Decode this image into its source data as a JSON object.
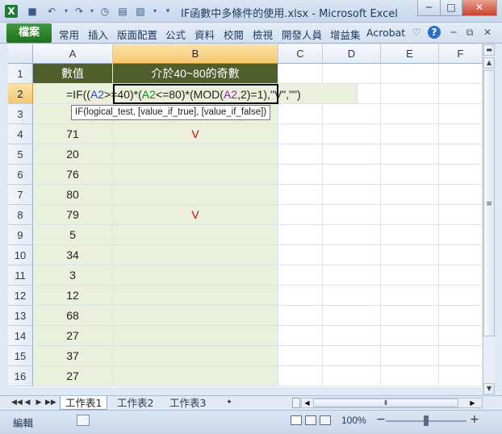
{
  "window": {
    "title": "IF函數中多條件的使用.xlsx - Microsoft Excel",
    "minimize": "─",
    "restore": "□",
    "close": "✕"
  },
  "quick_access": [
    "excel-app-icon",
    "save-icon",
    "undo-icon",
    "redo-icon",
    "clock-icon",
    "print-icon",
    "print-preview-icon",
    "customize-dropdown-icon"
  ],
  "ribbon": {
    "file_tab": "檔案",
    "tabs": [
      "常用",
      "插入",
      "版面配置",
      "公式",
      "資料",
      "校閱",
      "檢視",
      "開發人員",
      "增益集",
      "Acrobat"
    ],
    "icons": {
      "heart": "♡",
      "help": "?"
    }
  },
  "columns": [
    "A",
    "B",
    "C",
    "D",
    "E",
    "F"
  ],
  "rows": [
    "1",
    "2",
    "3",
    "4",
    "5",
    "6",
    "7",
    "8",
    "9",
    "10",
    "11",
    "12",
    "13",
    "14",
    "15",
    "16"
  ],
  "header_row": {
    "a": "數值",
    "b": "介於40~80的奇數"
  },
  "formula": {
    "p1": "=IF((",
    "p2": "A2",
    "p3": ">=40)*(",
    "p4": "A2",
    "p5": "<=80)*(MOD(",
    "p6": "A2",
    "p7": ",2)=1),\"V\",\"\")"
  },
  "tooltip": "IF(logical_test, [value_if_true], [value_if_false])",
  "data_rows": [
    {
      "row": "3",
      "a": "",
      "b": ""
    },
    {
      "row": "4",
      "a": "71",
      "b": "V"
    },
    {
      "row": "5",
      "a": "20",
      "b": ""
    },
    {
      "row": "6",
      "a": "76",
      "b": ""
    },
    {
      "row": "7",
      "a": "80",
      "b": ""
    },
    {
      "row": "8",
      "a": "79",
      "b": "V"
    },
    {
      "row": "9",
      "a": "5",
      "b": ""
    },
    {
      "row": "10",
      "a": "34",
      "b": ""
    },
    {
      "row": "11",
      "a": "3",
      "b": ""
    },
    {
      "row": "12",
      "a": "12",
      "b": ""
    },
    {
      "row": "13",
      "a": "68",
      "b": ""
    },
    {
      "row": "14",
      "a": "27",
      "b": ""
    },
    {
      "row": "15",
      "a": "37",
      "b": ""
    },
    {
      "row": "16",
      "a": "27",
      "b": ""
    }
  ],
  "sheet_tabs": [
    "工作表1",
    "工作表2",
    "工作表3"
  ],
  "status": {
    "mode": "編輯",
    "zoom": "100%",
    "zoom_minus": "−",
    "zoom_plus": "+"
  },
  "colors": {
    "header_fill": "#4f5e2b",
    "band_fill": "#eaf0dc",
    "mark_color": "#d00000",
    "file_tab": "#2a7d2a"
  }
}
